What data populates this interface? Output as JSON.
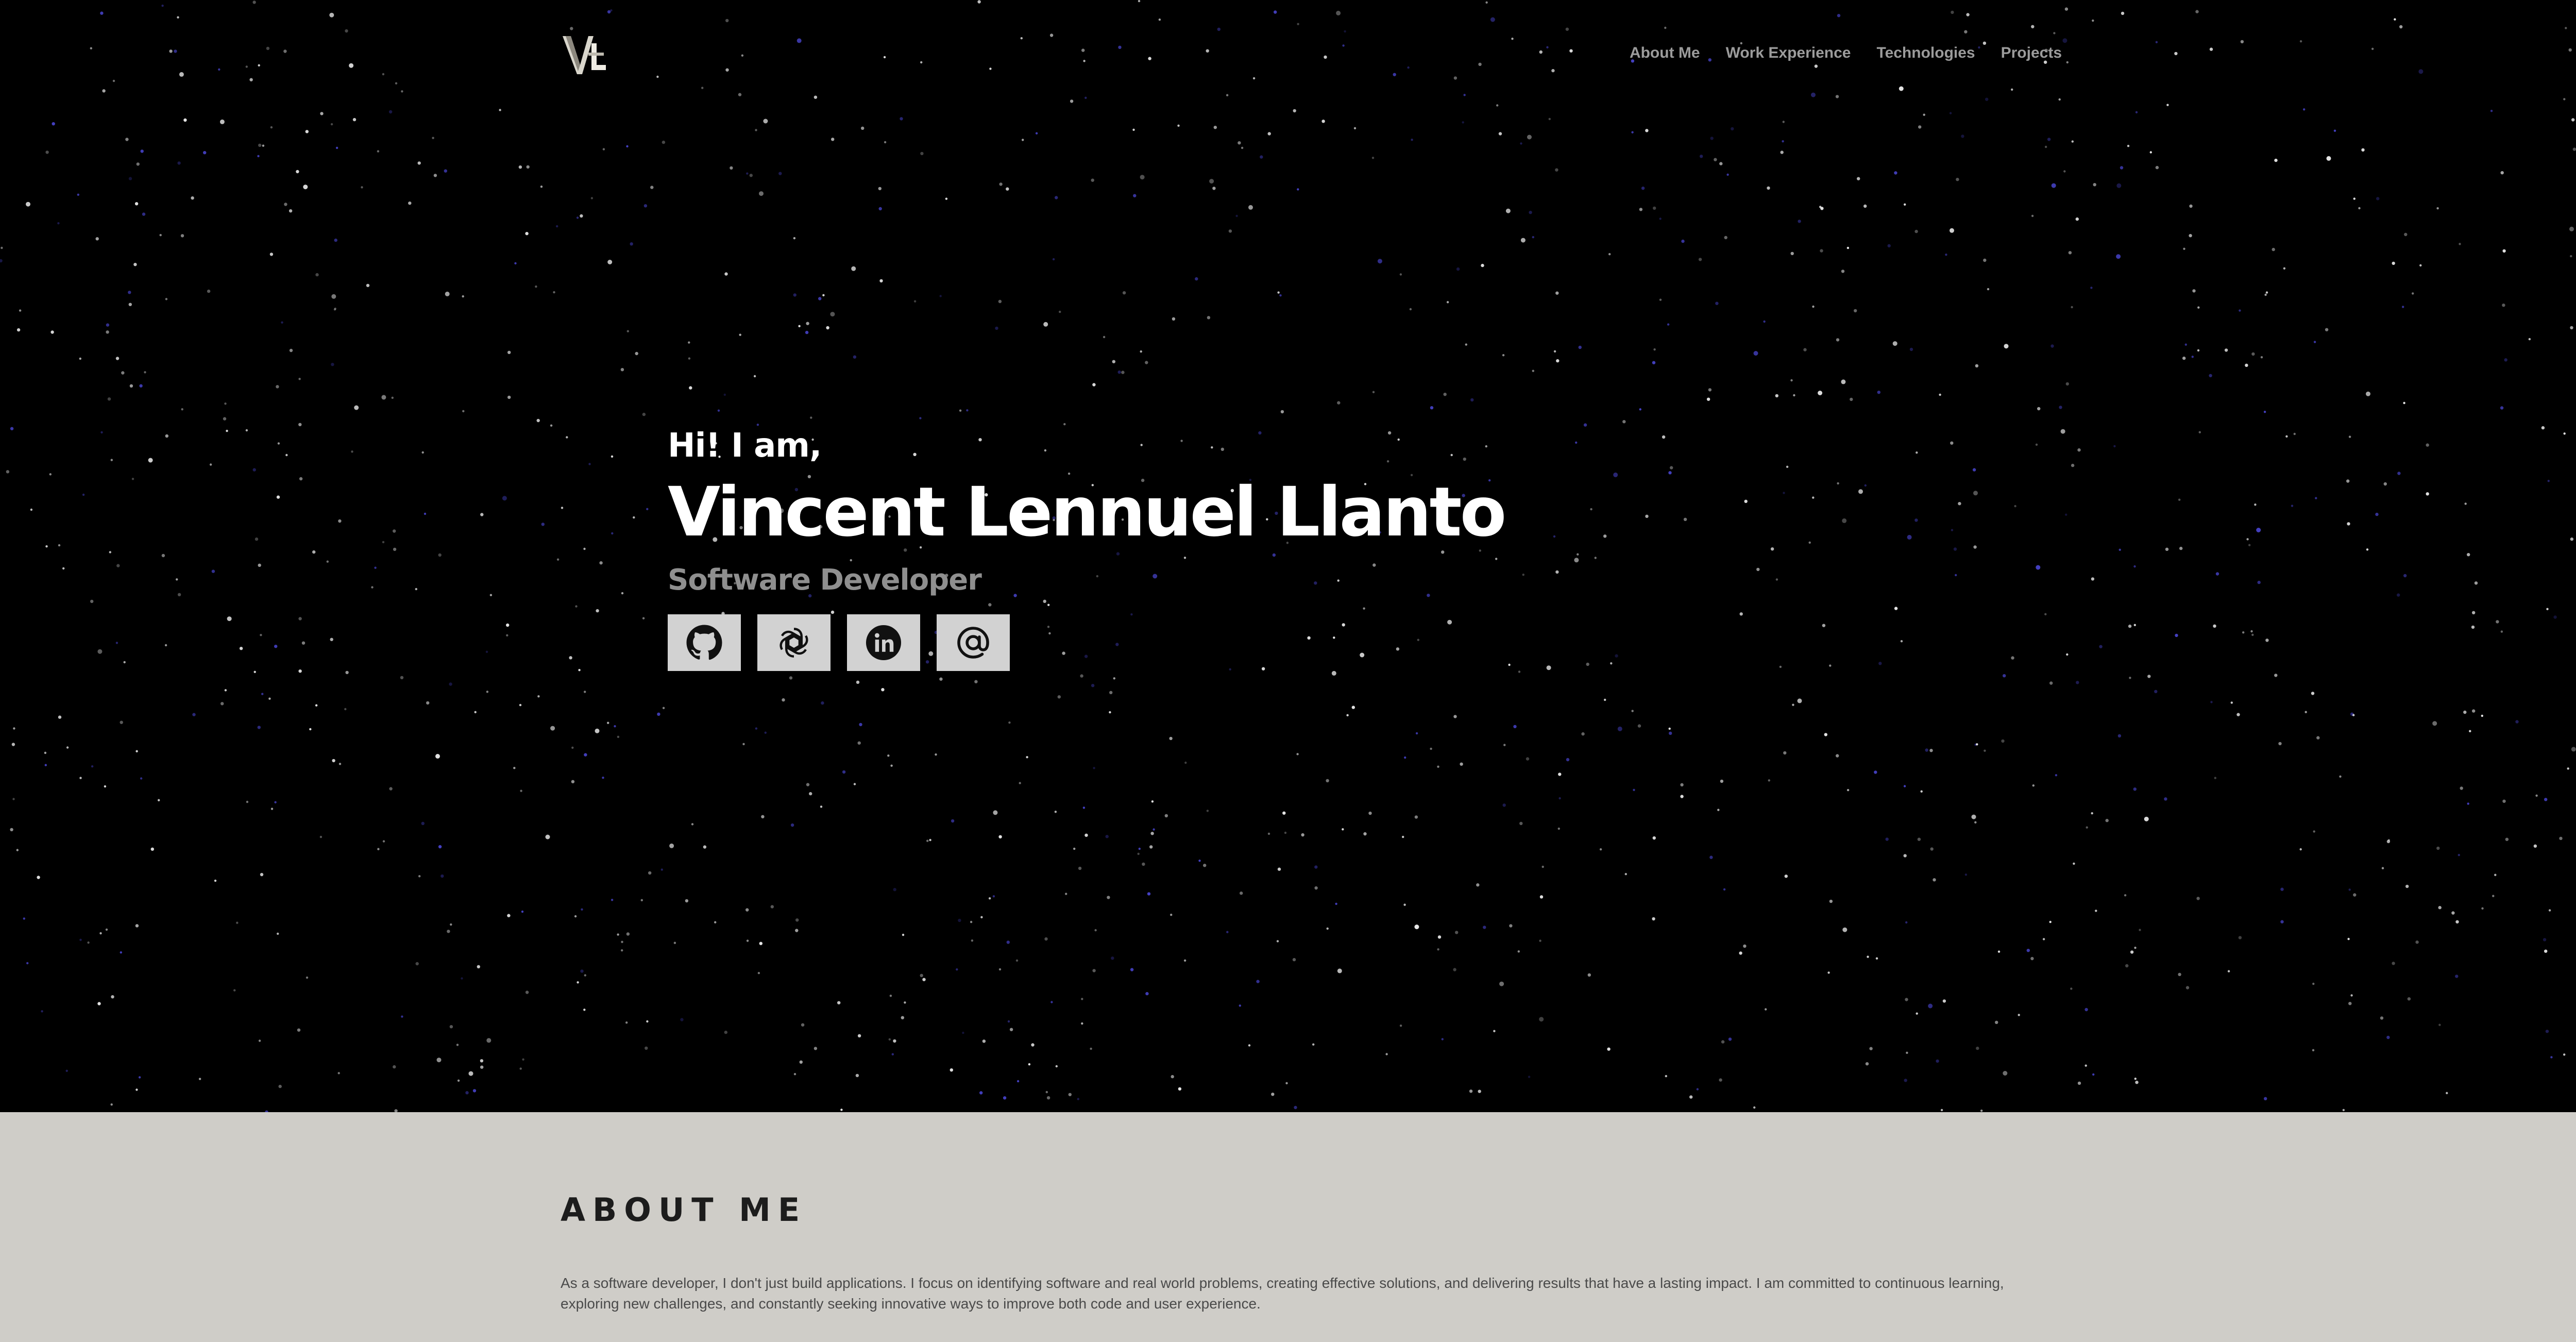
{
  "nav": {
    "logo_text": "VL",
    "links": [
      {
        "label": "About Me"
      },
      {
        "label": "Work Experience"
      },
      {
        "label": "Technologies"
      },
      {
        "label": "Projects"
      }
    ]
  },
  "hero": {
    "greeting": "Hi! I am,",
    "name": "Vincent Lennuel Llanto",
    "role": "Software Developer",
    "socials": [
      {
        "icon": "github-icon"
      },
      {
        "icon": "openai-icon"
      },
      {
        "icon": "linkedin-icon"
      },
      {
        "icon": "at-sign-icon"
      }
    ]
  },
  "about": {
    "title": "ABOUT ME",
    "text": "As a software developer, I don't just build applications. I focus on identifying software and real world problems, creating effective solutions, and delivering results that have a lasting impact. I am committed to continuous learning, exploring new challenges, and constantly seeking innovative ways to improve both code and user experience."
  },
  "colors": {
    "hero_background": "#000000",
    "about_background": "#cfcdc8",
    "nav_link": "#9b9b9b",
    "role_text": "#8f8f8f",
    "social_button": "#d2d2d2",
    "star_white": "#ffffff",
    "star_blue": "#4b47d6"
  }
}
